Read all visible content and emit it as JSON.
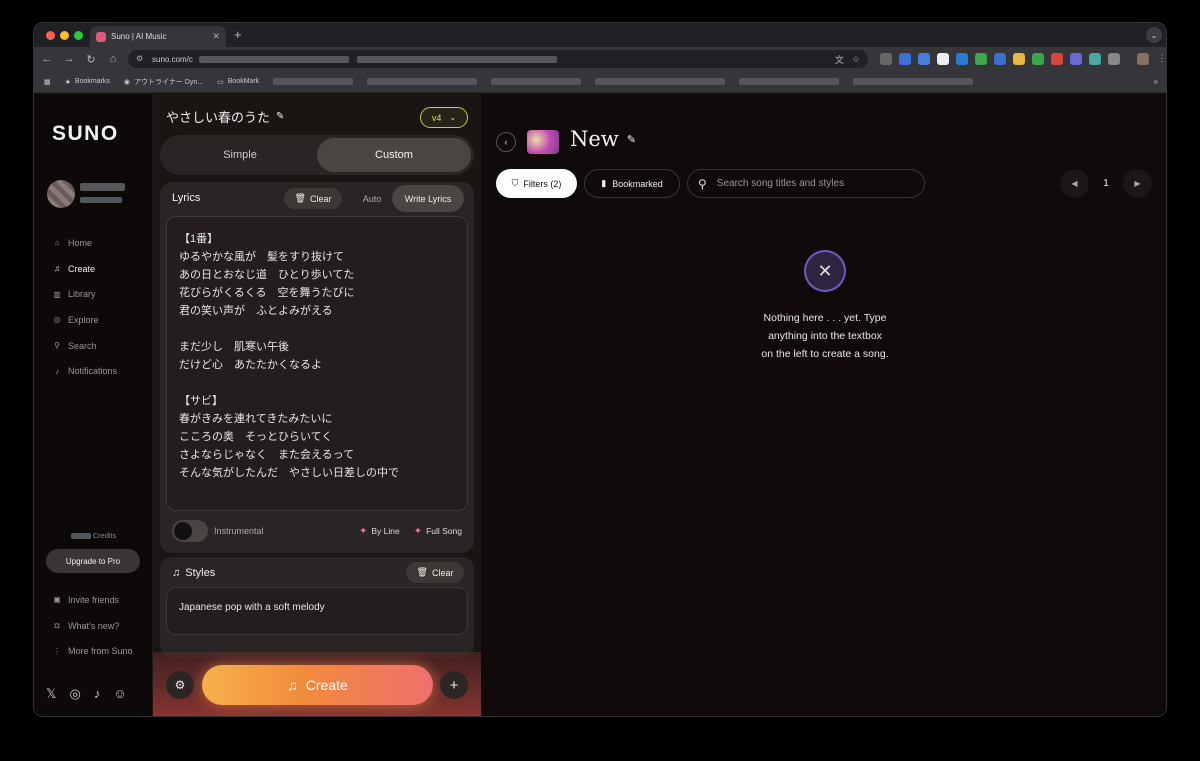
{
  "browser": {
    "tab_title": "Suno | AI Music",
    "url": "suno.com/c",
    "bookmarks": [
      "Bookmarks",
      "アウトライナー Dyn...",
      "BookMark"
    ]
  },
  "sidebar": {
    "logo": "SUNO",
    "nav": [
      {
        "label": "Home",
        "icon": "home-icon"
      },
      {
        "label": "Create",
        "icon": "music-note-icon"
      },
      {
        "label": "Library",
        "icon": "library-icon"
      },
      {
        "label": "Explore",
        "icon": "compass-icon"
      },
      {
        "label": "Search",
        "icon": "search-icon"
      },
      {
        "label": "Notifications",
        "icon": "bell-icon"
      }
    ],
    "credits_label": "Credits",
    "upgrade_label": "Upgrade to Pro",
    "nav2": [
      {
        "label": "Invite friends",
        "icon": "gift-icon"
      },
      {
        "label": "What's new?",
        "icon": "megaphone-icon"
      },
      {
        "label": "More from Suno",
        "icon": "more-vertical-icon"
      }
    ],
    "social": [
      "x-icon",
      "instagram-icon",
      "tiktok-icon",
      "discord-icon"
    ]
  },
  "panel": {
    "song_title": "やさしい春のうた",
    "version": "v4",
    "modes": [
      "Simple",
      "Custom"
    ],
    "active_mode": "Custom",
    "lyrics": {
      "title": "Lyrics",
      "clear_label": "Clear",
      "auto_label": "Auto",
      "write_label": "Write Lyrics",
      "lines": [
        "【1番】",
        "ゆるやかな風が　髪をすり抜けて",
        "あの日とおなじ道　ひとり歩いてた",
        "花びらがくるくる　空を舞うたびに",
        "君の笑い声が　ふとよみがえる",
        "",
        "まだ少し　肌寒い午後",
        "だけど心　あたたかくなるよ",
        "",
        "【サビ】",
        "春がきみを連れてきたみたいに",
        "こころの奥　そっとひらいてく",
        "さよならじゃなく　また会えるって",
        "そんな気がしたんだ　やさしい日差しの中で"
      ],
      "instrumental_label": "Instrumental",
      "by_line_label": "By Line",
      "full_song_label": "Full Song"
    },
    "styles": {
      "title": "Styles",
      "clear_label": "Clear",
      "value": "Japanese pop with a soft melody"
    },
    "create_label": "Create"
  },
  "main": {
    "workspace_title": "New",
    "filters_label": "Filters (2)",
    "bookmarked_label": "Bookmarked",
    "search_placeholder": "Search song titles and styles",
    "page": "1",
    "empty_lines": [
      "Nothing here . . . yet. Type",
      "anything into the textbox",
      "on the left to create a song."
    ]
  }
}
